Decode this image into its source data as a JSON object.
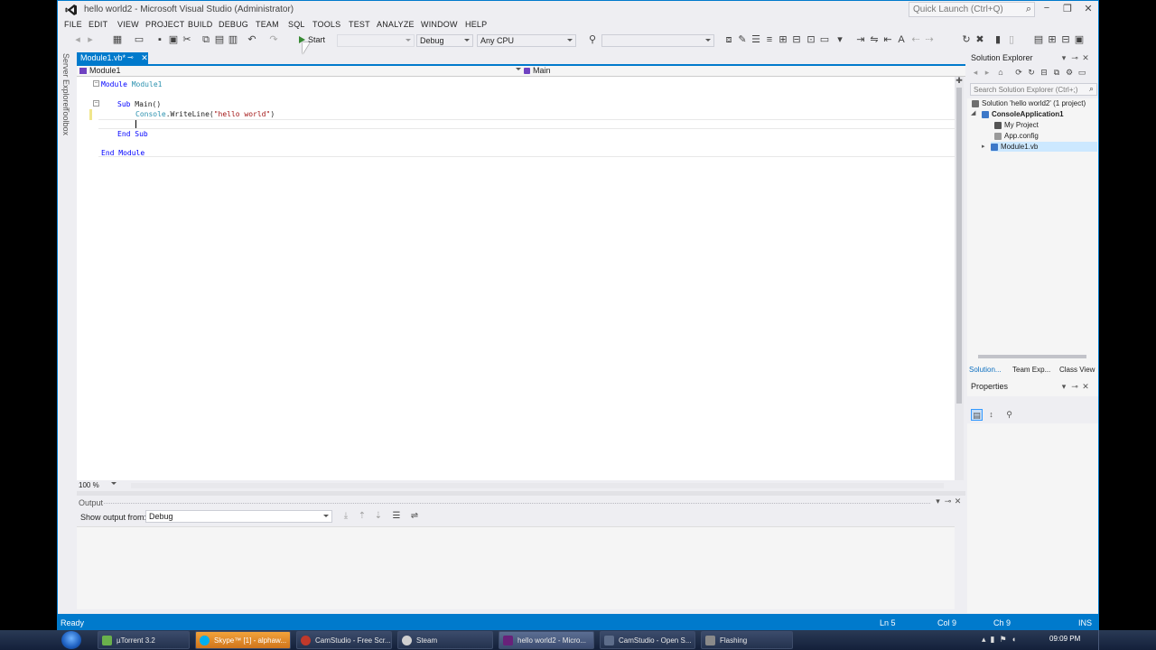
{
  "window": {
    "title": "hello world2 - Microsoft Visual Studio (Administrator)",
    "quick_launch_placeholder": "Quick Launch (Ctrl+Q)"
  },
  "menu": [
    "FILE",
    "EDIT",
    "VIEW",
    "PROJECT",
    "BUILD",
    "DEBUG",
    "TEAM",
    "SQL",
    "TOOLS",
    "TEST",
    "ANALYZE",
    "WINDOW",
    "HELP"
  ],
  "toolbar": {
    "start_label": "Start",
    "configuration": "Debug",
    "platform": "Any CPU"
  },
  "left_strip": {
    "server_explorer": "Server Explorer",
    "toolbox": "Toolbox"
  },
  "document": {
    "tab_label": "Module1.vb*",
    "nav_left": "Module1",
    "nav_right": "Main",
    "code": {
      "line1_kw": "Module",
      "line1_name": "Module1",
      "line3_kw": "Sub",
      "line3_name": "Main()",
      "line4_obj": "Console",
      "line4_call": ".WriteLine(",
      "line4_str": "\"hello world\"",
      "line4_end": ")",
      "line6_kw": "End Sub",
      "line8_kw": "End Module"
    },
    "zoom": "100 %"
  },
  "output": {
    "title": "Output",
    "show_from_label": "Show output from:",
    "show_from_value": "Debug"
  },
  "solution_explorer": {
    "title": "Solution Explorer",
    "search_placeholder": "Search Solution Explorer (Ctrl+;)",
    "tree": {
      "solution": "Solution 'hello world2' (1 project)",
      "project": "ConsoleApplication1",
      "my_project": "My Project",
      "app_config": "App.config",
      "module": "Module1.vb"
    },
    "tabs": {
      "solution": "Solution...",
      "team": "Team Exp...",
      "class_view": "Class View"
    }
  },
  "properties": {
    "title": "Properties"
  },
  "statusbar": {
    "ready": "Ready",
    "ln": "Ln 5",
    "col": "Col 9",
    "ch": "Ch 9",
    "mode": "INS"
  },
  "taskbar": {
    "items": [
      "µTorrent 3.2",
      "Skype™ [1] - alphaw...",
      "CamStudio - Free Scr...",
      "Steam",
      "hello world2 - Micro...",
      "CamStudio - Open S...",
      "Flashing"
    ],
    "clock": "09:09 PM"
  },
  "colors": {
    "accent": "#007acc",
    "keyword": "#0000ff",
    "string": "#a31515",
    "type": "#2b91af"
  }
}
